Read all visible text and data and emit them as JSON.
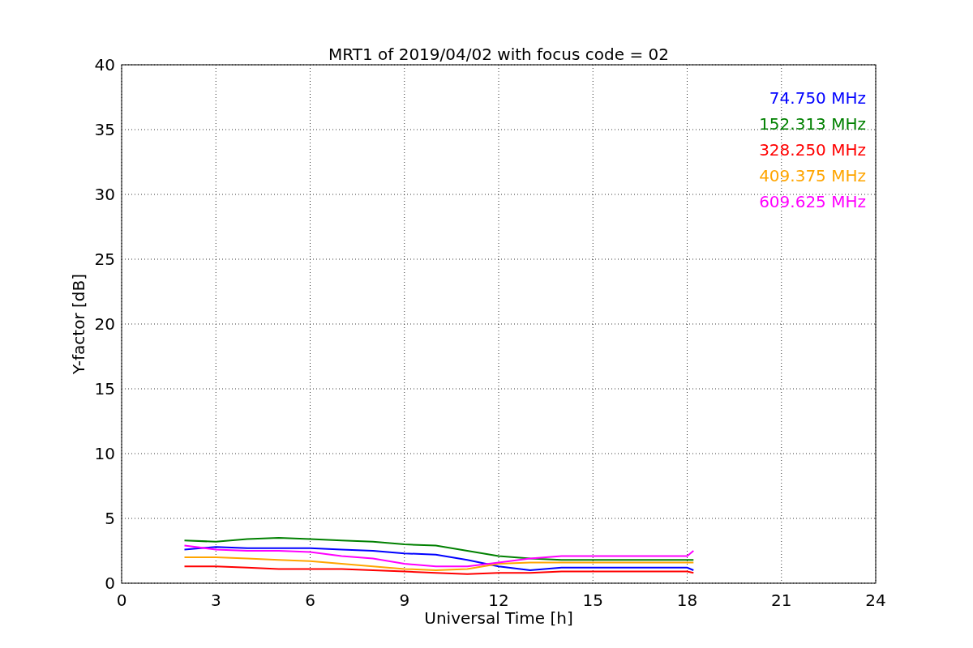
{
  "chart_data": {
    "type": "line",
    "title": "MRT1 of 2019/04/02 with focus code = 02",
    "xlabel": "Universal Time [h]",
    "ylabel": "Y-factor [dB]",
    "x": [
      2,
      3,
      4,
      5,
      6,
      7,
      8,
      9,
      10,
      11,
      12,
      13,
      14,
      18,
      18.2
    ],
    "series": [
      {
        "name": "74.750 MHz",
        "color": "#0000ff",
        "values": [
          2.6,
          2.8,
          2.7,
          2.7,
          2.7,
          2.6,
          2.5,
          2.3,
          2.2,
          1.8,
          1.3,
          1.0,
          1.2,
          1.2,
          1.0
        ]
      },
      {
        "name": "152.313 MHz",
        "color": "#008000",
        "values": [
          3.3,
          3.2,
          3.4,
          3.5,
          3.4,
          3.3,
          3.2,
          3.0,
          2.9,
          2.5,
          2.1,
          1.9,
          1.8,
          1.8,
          1.8
        ]
      },
      {
        "name": "328.250 MHz",
        "color": "#ff0000",
        "values": [
          1.3,
          1.3,
          1.2,
          1.1,
          1.1,
          1.1,
          1.0,
          0.9,
          0.8,
          0.7,
          0.8,
          0.8,
          0.9,
          0.9,
          0.8
        ]
      },
      {
        "name": "409.375 MHz",
        "color": "#ffa500",
        "values": [
          2.0,
          2.0,
          1.9,
          1.8,
          1.7,
          1.5,
          1.3,
          1.1,
          1.0,
          1.1,
          1.5,
          1.6,
          1.6,
          1.6,
          1.6
        ]
      },
      {
        "name": "609.625 MHz",
        "color": "#ff00ff",
        "values": [
          2.9,
          2.6,
          2.5,
          2.5,
          2.4,
          2.1,
          1.9,
          1.5,
          1.3,
          1.3,
          1.6,
          1.9,
          2.1,
          2.1,
          2.5
        ]
      }
    ],
    "grid": true,
    "xlim": [
      0,
      24
    ],
    "ylim": [
      0,
      40
    ],
    "xticks": [
      0,
      3,
      6,
      9,
      12,
      15,
      18,
      21,
      24
    ],
    "yticks": [
      0,
      5,
      10,
      15,
      20,
      25,
      30,
      35,
      40
    ]
  }
}
